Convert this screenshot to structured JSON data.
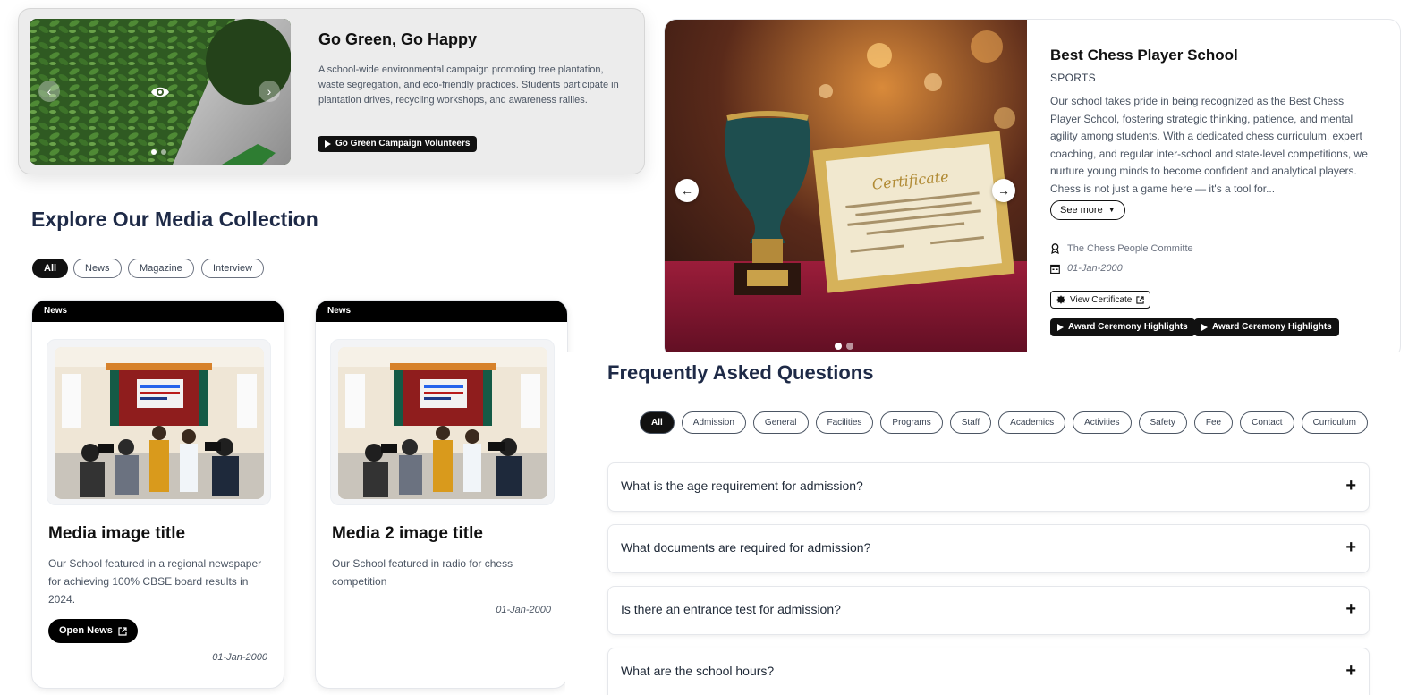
{
  "campaign": {
    "title": "Go Green, Go Happy",
    "description": "A school-wide environmental campaign promoting tree plantation, waste segregation, and eco-friendly practices. Students participate in plantation drives, recycling workshops, and awareness rallies.",
    "button_label": "Go Green Campaign Volunteers",
    "slide_count": 2,
    "active_slide": 1
  },
  "media": {
    "heading": "Explore Our Media Collection",
    "filters": [
      "All",
      "News",
      "Magazine",
      "Interview"
    ],
    "active_filter": "All",
    "cards": [
      {
        "category": "News",
        "title": "Media image title",
        "description": "Our School featured in a regional newspaper for achieving 100% CBSE board results in 2024.",
        "button_label": "Open News",
        "date": "01-Jan-2000"
      },
      {
        "category": "News",
        "title": "Media 2 image title",
        "description": "Our School featured in radio for chess competition",
        "date": "01-Jan-2000"
      }
    ]
  },
  "award": {
    "title": "Best Chess Player School",
    "category": "SPORTS",
    "description": "Our school takes pride in being recognized as the Best Chess Player School, fostering strategic thinking, patience, and mental agility among students. With a dedicated chess curriculum, expert coaching, and regular inter-school and state-level competitions, we nurture young minds to become confident and analytical players. Chess is not just a game here — it's a tool for...",
    "see_more_label": "See more",
    "committee": "The Chess People Committe",
    "date": "01-Jan-2000",
    "certificate_label": "View Certificate",
    "highlights": [
      "Award Ceremony Highlights",
      "Award Ceremony Highlights"
    ],
    "slide_count": 2,
    "active_slide": 1,
    "certificate_text": "Certificate"
  },
  "faq": {
    "heading": "Frequently Asked Questions",
    "filters": [
      "All",
      "Admission",
      "General",
      "Facilities",
      "Programs",
      "Staff",
      "Academics",
      "Activities",
      "Safety",
      "Fee",
      "Contact",
      "Curriculum"
    ],
    "active_filter": "All",
    "questions": [
      "What is the age requirement for admission?",
      "What documents are required for admission?",
      "Is there an entrance test for admission?",
      "What are the school hours?"
    ],
    "expand_symbol": "+"
  }
}
